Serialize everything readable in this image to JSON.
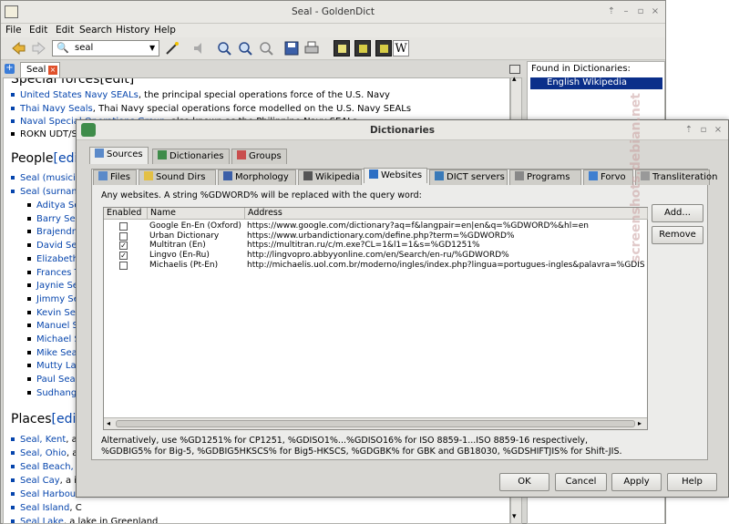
{
  "main": {
    "title": "Seal - GoldenDict",
    "menu": [
      "File",
      "Edit",
      "Search",
      "History",
      "Help"
    ],
    "search_value": "seal",
    "tab_label": "Seal",
    "right_pane_header": "Found in Dictionaries:",
    "right_pane_item": "English Wikipedia",
    "article": {
      "heading_partial": "Special forces[edit]",
      "special_items": [
        {
          "link": "United States Navy SEALs",
          "text": ", the principal special operations force of the U.S. Navy"
        },
        {
          "link": "Thai Navy Seals",
          "text": ", Thai Navy special operations force modelled on the U.S. Navy SEALs"
        },
        {
          "link": "Naval Special Operations Group",
          "text": ", also known as the Philippine Navy SEALs"
        },
        {
          "link": "",
          "text": "ROKN UDT/S"
        }
      ],
      "people_heading": "People",
      "edit": "[edit]",
      "people_items": [
        "Seal (musician)",
        "Seal (surname)"
      ],
      "people_sub": [
        "Aditya Seal",
        "Barry Seal",
        "Brajendra N",
        "David Seal",
        "Elizabeth S",
        "Frances Th",
        "Jaynie Seal",
        "Jimmy Seal",
        "Kevin Seal",
        "Manuel Se",
        "Michael Se",
        "Mike Seal",
        "Mutty Lall",
        "Paul Seal",
        "Sudhangsh"
      ],
      "places_heading": "Places",
      "places_items": [
        {
          "link": "Seal, Kent",
          "text": ", a vi"
        },
        {
          "link": "Seal, Ohio",
          "text": ", an"
        },
        {
          "link": "Seal Beach, C",
          "text": ""
        },
        {
          "link": "Seal Cay",
          "text": ", a is"
        },
        {
          "link": "Seal Harbour,",
          "text": ""
        },
        {
          "link": "Seal Island",
          "text": ", C"
        },
        {
          "link": "Seal Lake",
          "text": ", a lake in Greenland"
        }
      ]
    }
  },
  "dialog": {
    "title": "Dictionaries",
    "top_tabs": [
      "Sources",
      "Dictionaries",
      "Groups"
    ],
    "sub_tabs": [
      "Files",
      "Sound Dirs",
      "Morphology",
      "Wikipedia",
      "Websites",
      "DICT servers",
      "Programs",
      "Forvo",
      "Transliteration"
    ],
    "description": "Any websites. A string %GDWORD% will be replaced with the query word:",
    "columns": [
      "Enabled",
      "Name",
      "Address"
    ],
    "rows": [
      {
        "enabled": false,
        "name": "Google En-En (Oxford)",
        "address": "https://www.google.com/dictionary?aq=f&langpair=en|en&q=%GDWORD%&hl=en"
      },
      {
        "enabled": false,
        "name": "Urban Dictionary",
        "address": "https://www.urbandictionary.com/define.php?term=%GDWORD%"
      },
      {
        "enabled": true,
        "name": "Multitran (En)",
        "address": "https://multitran.ru/c/m.exe?CL=1&l1=1&s=%GD1251%"
      },
      {
        "enabled": true,
        "name": "Lingvo (En-Ru)",
        "address": "http://lingvopro.abbyyonline.com/en/Search/en-ru/%GDWORD%"
      },
      {
        "enabled": false,
        "name": "Michaelis (Pt-En)",
        "address": "http://michaelis.uol.com.br/moderno/ingles/index.php?lingua=portugues-ingles&palavra=%GDIS"
      }
    ],
    "add_button": "Add...",
    "remove_button": "Remove",
    "footer_line1": "Alternatively, use %GD1251% for CP1251, %GDISO1%...%GDISO16% for ISO 8859-1...ISO 8859-16 respectively,",
    "footer_line2": "%GDBIG5% for Big-5, %GDBIG5HKSCS% for Big5-HKSCS, %GDGBK% for GBK and GB18030, %GDSHIFTJIS% for Shift-JIS.",
    "ok": "OK",
    "cancel": "Cancel",
    "apply": "Apply",
    "help": "Help"
  },
  "watermark": "screenshots.debian.net",
  "colors": {
    "selection": "#0b2f8a",
    "link": "#0645ad"
  }
}
